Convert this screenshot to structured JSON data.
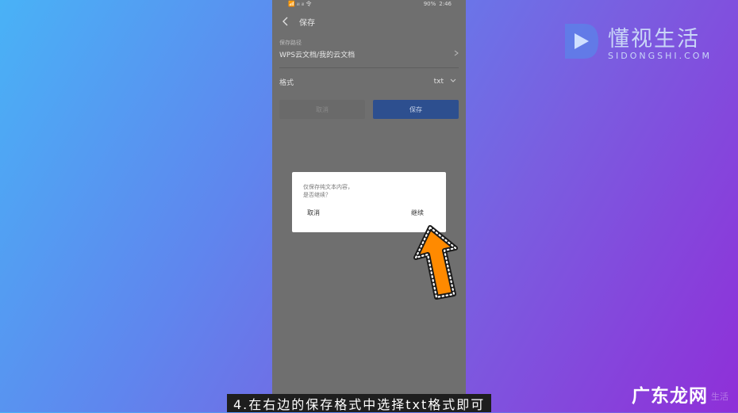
{
  "status": {
    "left": "📶 ᵢₗₗ ᵢₗₗ 令",
    "battery": "90%",
    "time": "2:46"
  },
  "titlebar": {
    "title": "保存"
  },
  "save_path": {
    "label": "保存路径",
    "value": "WPS云文档/我的云文档"
  },
  "format": {
    "label": "格式",
    "value": "txt"
  },
  "buttons": {
    "cancel": "取消",
    "save": "保存"
  },
  "dialog": {
    "line1": "仅保存纯文本内容，",
    "line2": "是否继续？",
    "cancel": "取消",
    "continue": "继续"
  },
  "logo": {
    "cn": "懂视生活",
    "en": "SIDONGSHI.COM"
  },
  "caption": "4.在右边的保存格式中选择txt格式即可",
  "watermark": {
    "main": "广东龙网",
    "sub": "生活"
  },
  "colors": {
    "arrow": "#ff8a00",
    "save_button": "#2d4f8f"
  }
}
